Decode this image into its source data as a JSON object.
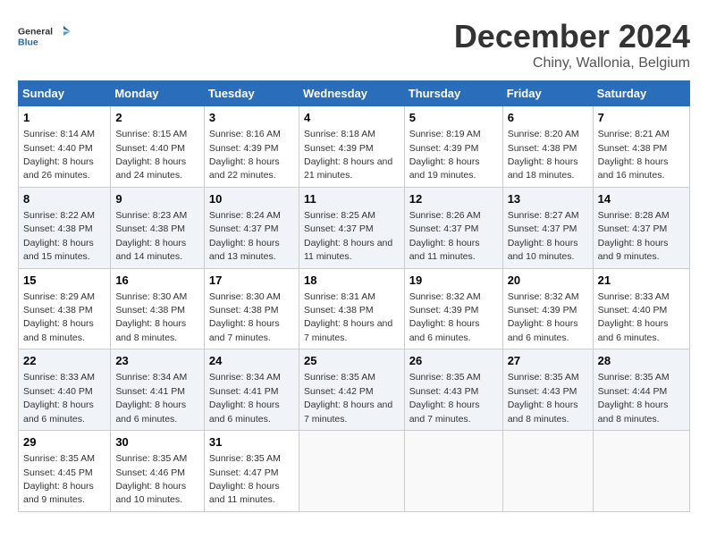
{
  "logo": {
    "text_general": "General",
    "text_blue": "Blue"
  },
  "title": "December 2024",
  "subtitle": "Chiny, Wallonia, Belgium",
  "days_header": [
    "Sunday",
    "Monday",
    "Tuesday",
    "Wednesday",
    "Thursday",
    "Friday",
    "Saturday"
  ],
  "weeks": [
    [
      {
        "day": "1",
        "sunrise": "Sunrise: 8:14 AM",
        "sunset": "Sunset: 4:40 PM",
        "daylight": "Daylight: 8 hours and 26 minutes."
      },
      {
        "day": "2",
        "sunrise": "Sunrise: 8:15 AM",
        "sunset": "Sunset: 4:40 PM",
        "daylight": "Daylight: 8 hours and 24 minutes."
      },
      {
        "day": "3",
        "sunrise": "Sunrise: 8:16 AM",
        "sunset": "Sunset: 4:39 PM",
        "daylight": "Daylight: 8 hours and 22 minutes."
      },
      {
        "day": "4",
        "sunrise": "Sunrise: 8:18 AM",
        "sunset": "Sunset: 4:39 PM",
        "daylight": "Daylight: 8 hours and 21 minutes."
      },
      {
        "day": "5",
        "sunrise": "Sunrise: 8:19 AM",
        "sunset": "Sunset: 4:39 PM",
        "daylight": "Daylight: 8 hours and 19 minutes."
      },
      {
        "day": "6",
        "sunrise": "Sunrise: 8:20 AM",
        "sunset": "Sunset: 4:38 PM",
        "daylight": "Daylight: 8 hours and 18 minutes."
      },
      {
        "day": "7",
        "sunrise": "Sunrise: 8:21 AM",
        "sunset": "Sunset: 4:38 PM",
        "daylight": "Daylight: 8 hours and 16 minutes."
      }
    ],
    [
      {
        "day": "8",
        "sunrise": "Sunrise: 8:22 AM",
        "sunset": "Sunset: 4:38 PM",
        "daylight": "Daylight: 8 hours and 15 minutes."
      },
      {
        "day": "9",
        "sunrise": "Sunrise: 8:23 AM",
        "sunset": "Sunset: 4:38 PM",
        "daylight": "Daylight: 8 hours and 14 minutes."
      },
      {
        "day": "10",
        "sunrise": "Sunrise: 8:24 AM",
        "sunset": "Sunset: 4:37 PM",
        "daylight": "Daylight: 8 hours and 13 minutes."
      },
      {
        "day": "11",
        "sunrise": "Sunrise: 8:25 AM",
        "sunset": "Sunset: 4:37 PM",
        "daylight": "Daylight: 8 hours and 11 minutes."
      },
      {
        "day": "12",
        "sunrise": "Sunrise: 8:26 AM",
        "sunset": "Sunset: 4:37 PM",
        "daylight": "Daylight: 8 hours and 11 minutes."
      },
      {
        "day": "13",
        "sunrise": "Sunrise: 8:27 AM",
        "sunset": "Sunset: 4:37 PM",
        "daylight": "Daylight: 8 hours and 10 minutes."
      },
      {
        "day": "14",
        "sunrise": "Sunrise: 8:28 AM",
        "sunset": "Sunset: 4:37 PM",
        "daylight": "Daylight: 8 hours and 9 minutes."
      }
    ],
    [
      {
        "day": "15",
        "sunrise": "Sunrise: 8:29 AM",
        "sunset": "Sunset: 4:38 PM",
        "daylight": "Daylight: 8 hours and 8 minutes."
      },
      {
        "day": "16",
        "sunrise": "Sunrise: 8:30 AM",
        "sunset": "Sunset: 4:38 PM",
        "daylight": "Daylight: 8 hours and 8 minutes."
      },
      {
        "day": "17",
        "sunrise": "Sunrise: 8:30 AM",
        "sunset": "Sunset: 4:38 PM",
        "daylight": "Daylight: 8 hours and 7 minutes."
      },
      {
        "day": "18",
        "sunrise": "Sunrise: 8:31 AM",
        "sunset": "Sunset: 4:38 PM",
        "daylight": "Daylight: 8 hours and 7 minutes."
      },
      {
        "day": "19",
        "sunrise": "Sunrise: 8:32 AM",
        "sunset": "Sunset: 4:39 PM",
        "daylight": "Daylight: 8 hours and 6 minutes."
      },
      {
        "day": "20",
        "sunrise": "Sunrise: 8:32 AM",
        "sunset": "Sunset: 4:39 PM",
        "daylight": "Daylight: 8 hours and 6 minutes."
      },
      {
        "day": "21",
        "sunrise": "Sunrise: 8:33 AM",
        "sunset": "Sunset: 4:40 PM",
        "daylight": "Daylight: 8 hours and 6 minutes."
      }
    ],
    [
      {
        "day": "22",
        "sunrise": "Sunrise: 8:33 AM",
        "sunset": "Sunset: 4:40 PM",
        "daylight": "Daylight: 8 hours and 6 minutes."
      },
      {
        "day": "23",
        "sunrise": "Sunrise: 8:34 AM",
        "sunset": "Sunset: 4:41 PM",
        "daylight": "Daylight: 8 hours and 6 minutes."
      },
      {
        "day": "24",
        "sunrise": "Sunrise: 8:34 AM",
        "sunset": "Sunset: 4:41 PM",
        "daylight": "Daylight: 8 hours and 6 minutes."
      },
      {
        "day": "25",
        "sunrise": "Sunrise: 8:35 AM",
        "sunset": "Sunset: 4:42 PM",
        "daylight": "Daylight: 8 hours and 7 minutes."
      },
      {
        "day": "26",
        "sunrise": "Sunrise: 8:35 AM",
        "sunset": "Sunset: 4:43 PM",
        "daylight": "Daylight: 8 hours and 7 minutes."
      },
      {
        "day": "27",
        "sunrise": "Sunrise: 8:35 AM",
        "sunset": "Sunset: 4:43 PM",
        "daylight": "Daylight: 8 hours and 8 minutes."
      },
      {
        "day": "28",
        "sunrise": "Sunrise: 8:35 AM",
        "sunset": "Sunset: 4:44 PM",
        "daylight": "Daylight: 8 hours and 8 minutes."
      }
    ],
    [
      {
        "day": "29",
        "sunrise": "Sunrise: 8:35 AM",
        "sunset": "Sunset: 4:45 PM",
        "daylight": "Daylight: 8 hours and 9 minutes."
      },
      {
        "day": "30",
        "sunrise": "Sunrise: 8:35 AM",
        "sunset": "Sunset: 4:46 PM",
        "daylight": "Daylight: 8 hours and 10 minutes."
      },
      {
        "day": "31",
        "sunrise": "Sunrise: 8:35 AM",
        "sunset": "Sunset: 4:47 PM",
        "daylight": "Daylight: 8 hours and 11 minutes."
      },
      null,
      null,
      null,
      null
    ]
  ]
}
